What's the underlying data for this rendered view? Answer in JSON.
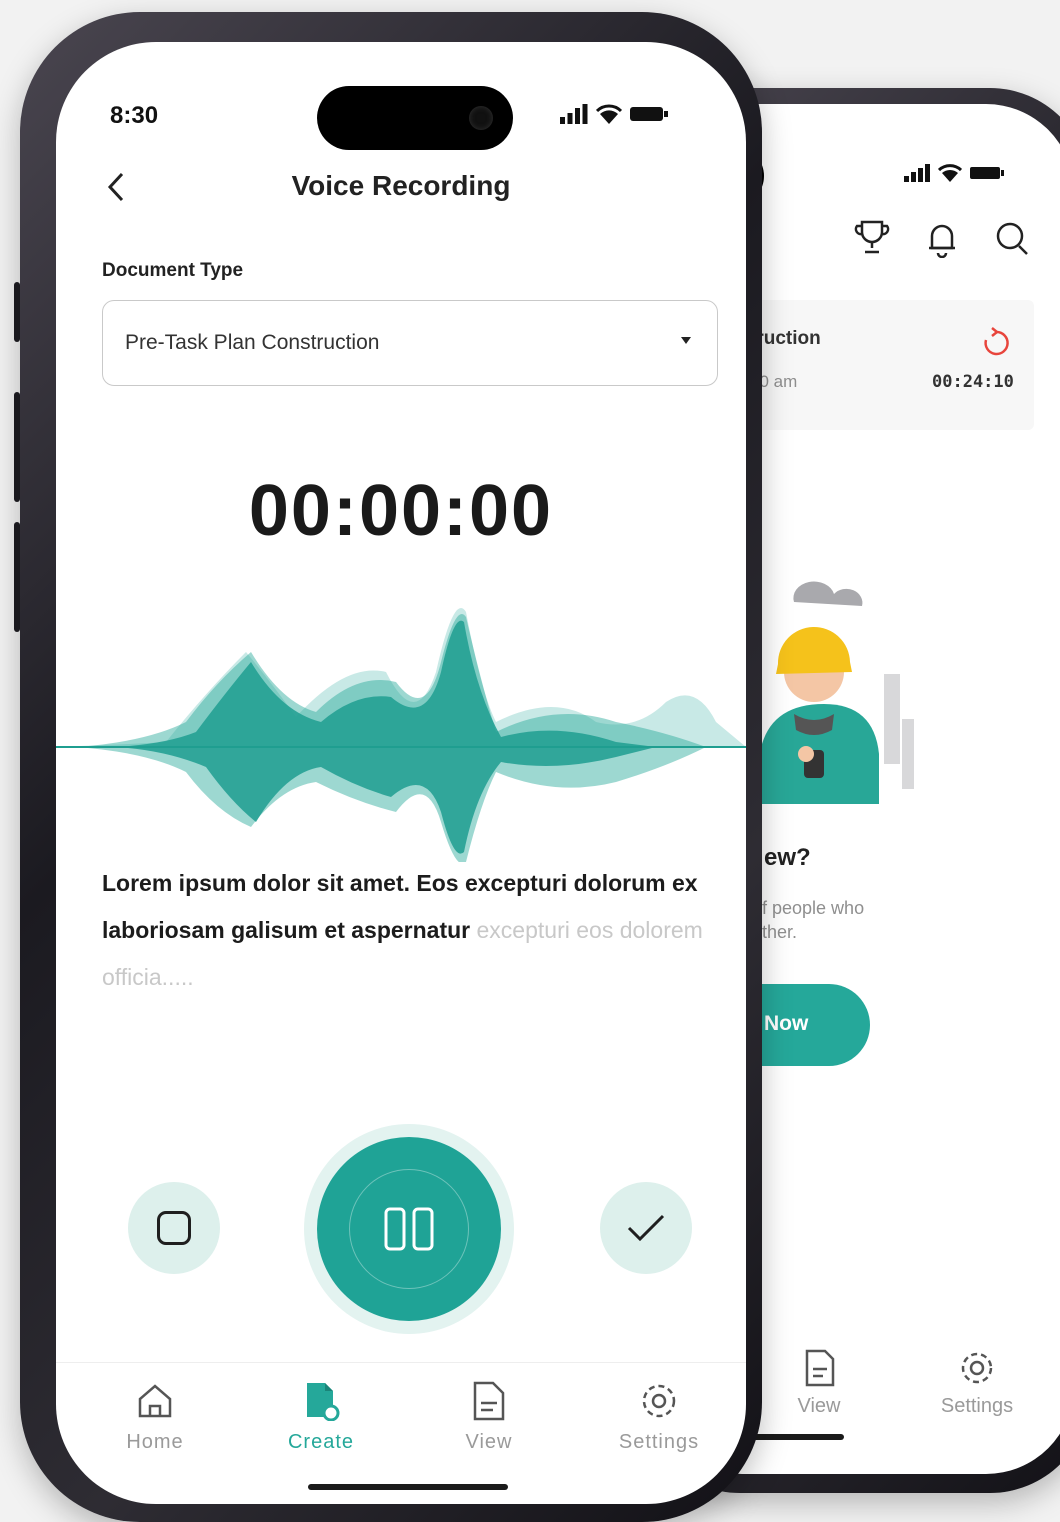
{
  "colors": {
    "accent": "#25a89a",
    "accent_light": "#ddf0ec",
    "bg": "#f2f2f2"
  },
  "front": {
    "status": {
      "time": "8:30"
    },
    "header": {
      "back_icon": "chevron-left-icon",
      "title": "Voice Recording"
    },
    "document_type": {
      "label": "Document Type",
      "value": "Pre-Task Plan Construction"
    },
    "timer": "00:00:00",
    "transcript": {
      "bold_text": "Lorem ipsum dolor sit amet. Eos excepturi dolorum ex laboriosam galisum et  aspernatur",
      "faded_text": "excepturi eos dolorem officia....."
    },
    "controls": {
      "stop_icon": "stop-icon",
      "pause_icon": "pause-icon",
      "confirm_icon": "check-icon"
    },
    "nav": [
      {
        "label": "Home",
        "icon": "home-icon",
        "active": false
      },
      {
        "label": "Create",
        "icon": "create-document-icon",
        "active": true
      },
      {
        "label": "View",
        "icon": "document-icon",
        "active": false
      },
      {
        "label": "Settings",
        "icon": "gear-icon",
        "active": false
      }
    ]
  },
  "back": {
    "header_icons": [
      "trophy-icon",
      "bell-icon",
      "search-icon"
    ],
    "recent": {
      "title": "truction",
      "subtitle": "30 am",
      "duration": "00:24:10",
      "refresh_icon": "refresh-icon"
    },
    "empty_state": {
      "heading": "ew?",
      "line1": "f people who",
      "line2": "ther.",
      "button": "Now"
    },
    "nav": [
      {
        "label": "View",
        "icon": "document-icon"
      },
      {
        "label": "Settings",
        "icon": "gear-icon"
      }
    ]
  }
}
